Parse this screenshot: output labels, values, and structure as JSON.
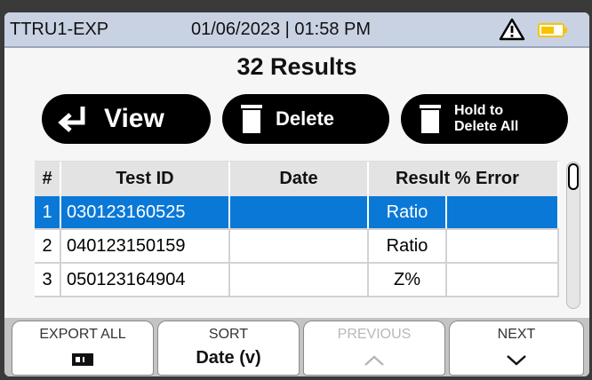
{
  "status": {
    "device": "TTRU1-EXP",
    "datetime": "01/06/2023 | 01:58 PM",
    "warning_icon": "warning-triangle-icon",
    "battery_icon": "battery-icon",
    "battery_color": "#f5c400"
  },
  "results_title": "32 Results",
  "actions": {
    "view_label": "View",
    "delete_label": "Delete",
    "hold_line1": "Hold to",
    "hold_line2": "Delete All"
  },
  "table": {
    "headers": {
      "num": "#",
      "test_id": "Test ID",
      "date": "Date",
      "result_error": "Result % Error"
    },
    "rows": [
      {
        "num": "1",
        "test_id": "030123160525",
        "date": "",
        "result": "Ratio",
        "error": ""
      },
      {
        "num": "2",
        "test_id": "040123150159",
        "date": "",
        "result": "Ratio",
        "error": ""
      },
      {
        "num": "3",
        "test_id": "050123164904",
        "date": "",
        "result": "Z%",
        "error": ""
      }
    ],
    "selected_row": 1,
    "selection_color": "#0a78d7"
  },
  "softkeys": {
    "export_label": "EXPORT ALL",
    "export_icon": "usb-icon",
    "sort_label": "SORT",
    "sort_value": "Date (v)",
    "previous_label": "PREVIOUS",
    "previous_icon": "chevron-up-icon",
    "next_label": "NEXT",
    "next_icon": "chevron-down-icon"
  }
}
